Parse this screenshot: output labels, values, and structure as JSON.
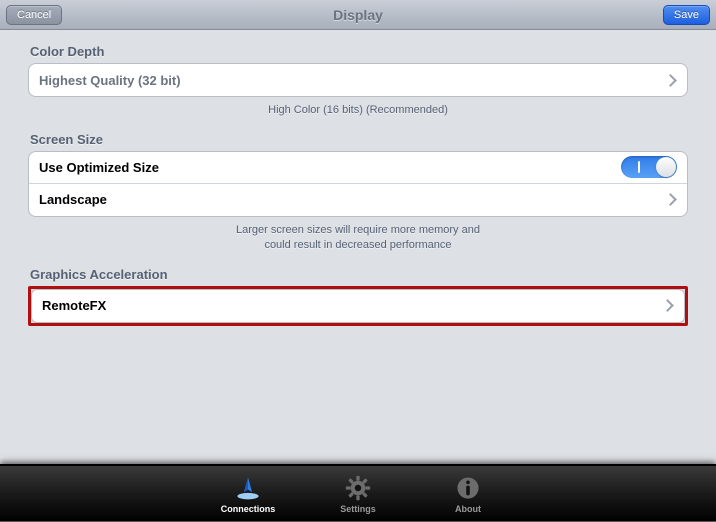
{
  "navbar": {
    "title": "Display",
    "cancel": "Cancel",
    "save": "Save"
  },
  "sections": {
    "colorDepth": {
      "header": "Color Depth",
      "value": "Highest Quality (32 bit)",
      "hint": "High Color (16 bits) (Recommended)"
    },
    "screenSize": {
      "header": "Screen Size",
      "optimized": {
        "label": "Use Optimized Size",
        "on": true
      },
      "orientation": "Landscape",
      "hint": "Larger screen sizes will require more memory and could result in decreased performance"
    },
    "graphics": {
      "header": "Graphics Acceleration",
      "value": "RemoteFX"
    }
  },
  "tabs": {
    "connections": "Connections",
    "settings": "Settings",
    "about": "About"
  }
}
